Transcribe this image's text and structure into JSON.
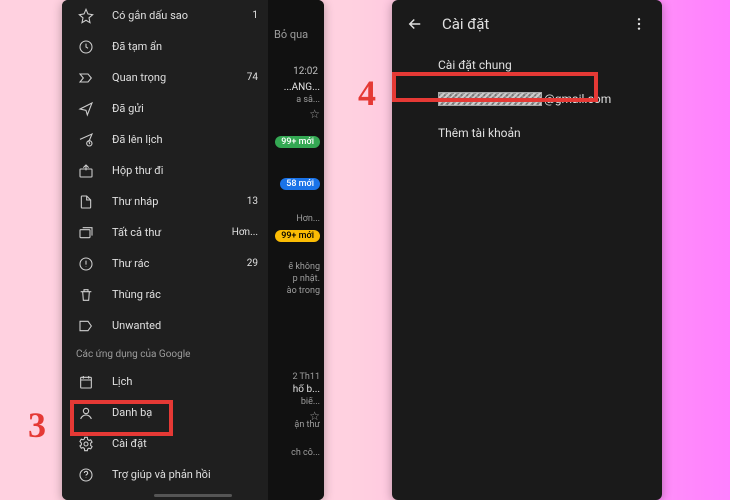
{
  "callouts": {
    "num3": "3",
    "num4": "4"
  },
  "left_phone": {
    "strip": {
      "skip": "Bỏ qua",
      "time": "12:02",
      "row1_title": "...ANG...",
      "row1_sub": "a sâ...",
      "badge_green": "99+ mới",
      "badge_blue": "58 mới",
      "row4_sub": "Hơn...",
      "badge_orange": "99+ mới",
      "row5_a": "ế không",
      "row5_b": "p nhật.",
      "row5_c": "ào trong",
      "row6_date": "2 Th11",
      "row6_title": "hổ b...",
      "row6_sub": "biế...",
      "row7": "ận thư",
      "row8": "ch cô..."
    },
    "drawer": {
      "section_google_apps": "Các ứng dụng của Google",
      "items": [
        {
          "icon": "star",
          "label": "Có gắn dấu sao",
          "count": "1"
        },
        {
          "icon": "clock",
          "label": "Đã tạm ẩn",
          "count": ""
        },
        {
          "icon": "important",
          "label": "Quan trọng",
          "count": "74"
        },
        {
          "icon": "sent",
          "label": "Đã gửi",
          "count": ""
        },
        {
          "icon": "scheduled",
          "label": "Đã lên lịch",
          "count": ""
        },
        {
          "icon": "outbox",
          "label": "Hộp thư đi",
          "count": ""
        },
        {
          "icon": "draft",
          "label": "Thư nháp",
          "count": "13"
        },
        {
          "icon": "allmail",
          "label": "Tất cả thư",
          "count": "Hơn..."
        },
        {
          "icon": "spam",
          "label": "Thư rác",
          "count": "29"
        },
        {
          "icon": "trash",
          "label": "Thùng rác",
          "count": ""
        },
        {
          "icon": "label",
          "label": "Unwanted",
          "count": ""
        },
        {
          "icon": "calendar",
          "label": "Lịch",
          "count": ""
        },
        {
          "icon": "contacts",
          "label": "Danh bạ",
          "count": ""
        },
        {
          "icon": "settings",
          "label": "Cài đặt",
          "count": ""
        },
        {
          "icon": "help",
          "label": "Trợ giúp và phản hồi",
          "count": ""
        }
      ]
    }
  },
  "right_phone": {
    "title": "Cài đặt",
    "general": "Cài đặt chung",
    "email_suffix": "@gmail.com",
    "add_account": "Thêm tài khoản"
  }
}
